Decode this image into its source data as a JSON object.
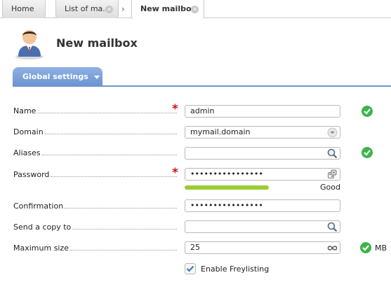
{
  "tabs": [
    {
      "label": "Home"
    },
    {
      "label": "List of ma..."
    },
    {
      "label": "New mailbox"
    }
  ],
  "page": {
    "title": "New mailbox"
  },
  "section": {
    "label": "Global settings"
  },
  "form": {
    "name": {
      "label": "Name",
      "value": "admin",
      "required": "*"
    },
    "domain": {
      "label": "Domain",
      "value": "mymail.domain"
    },
    "aliases": {
      "label": "Aliases",
      "value": ""
    },
    "password": {
      "label": "Password",
      "value": "••••••••••••••••",
      "required": "*",
      "strength": "Good",
      "strength_level": 0.5
    },
    "confirmation": {
      "label": "Confirmation",
      "value": "••••••••••••••••"
    },
    "copy_to": {
      "label": "Send a copy to",
      "value": ""
    },
    "max_size": {
      "label": "Maximum size",
      "value": "25",
      "unit": "MB"
    },
    "freylisting": {
      "label": "Enable Freylisting",
      "checked": true
    }
  },
  "icons": {
    "avatar": "user-avatar-icon",
    "ok": "check-circle-icon",
    "search": "magnifier-icon",
    "dropdown": "chevron-down-icon",
    "password_gen": "dice-icon",
    "infinity": "infinity-icon"
  },
  "colors": {
    "accent": "#6e95d0",
    "ok": "#3db34a",
    "strength": "#9acd32",
    "required": "#cc1111"
  }
}
